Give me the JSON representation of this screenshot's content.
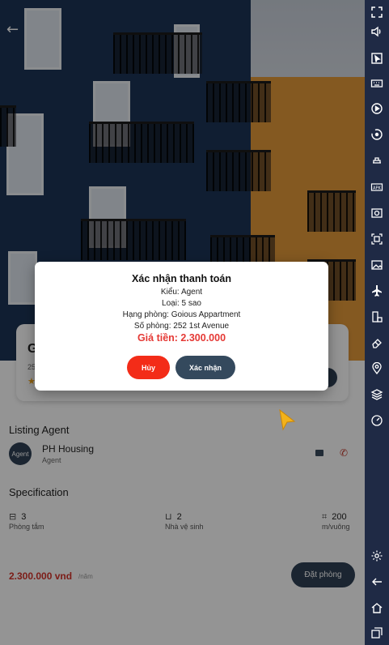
{
  "property": {
    "title_initial": "G",
    "address_initial": "25",
    "rating_icon": "star-icon"
  },
  "agent_section": {
    "title": "Listing Agent",
    "avatar_text": "Agent",
    "name": "PH Housing",
    "role": "Agent"
  },
  "spec_section": {
    "title": "Specification",
    "items": [
      {
        "icon": "bed-icon",
        "value": "3",
        "label": "Phòng tắm"
      },
      {
        "icon": "bath-icon",
        "value": "2",
        "label": "Nhà vệ sinh"
      },
      {
        "icon": "area-icon",
        "value": "200",
        "label": "m/vuông"
      }
    ]
  },
  "footer": {
    "price": "2.300.000 vnd",
    "price_unit": "/năm",
    "book_label": "Đặt phòng"
  },
  "dialog": {
    "title": "Xác nhận thanh toán",
    "kind": "Kiểu: Agent",
    "type": "Loại: 5 sao",
    "room_class": "Hạng phòng: Goious Appartment",
    "room_number": "Số phòng: 252 1st Avenue",
    "price": "Giá tiền: 2.300.000",
    "cancel_label": "Hủy",
    "confirm_label": "Xác nhận"
  },
  "toolbar_icons": [
    "expand-icon",
    "volume-icon",
    "pointer-icon",
    "keyboard-icon",
    "record-icon",
    "sync-icon",
    "gamepad-icon",
    "apk-icon",
    "screenshot-icon",
    "crop-icon",
    "gallery-icon",
    "airplane-icon",
    "rotate-icon",
    "erase-icon",
    "location-icon",
    "layers-icon",
    "speed-icon",
    "settings-icon",
    "back-icon",
    "home-icon",
    "recents-icon"
  ],
  "colors": {
    "accent_red": "#e53935",
    "cancel_red": "#f32c18",
    "navy": "#34495d",
    "toolbar": "#1f2a45"
  }
}
